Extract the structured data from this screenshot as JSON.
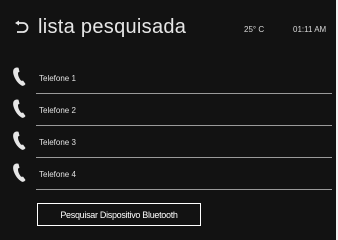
{
  "header": {
    "back_icon": "back-arrow-icon",
    "title": "lista pesquisada",
    "temperature": "25° C",
    "time": "01:11 AM"
  },
  "devices": [
    {
      "label": "Telefone 1",
      "icon": "phone-icon"
    },
    {
      "label": "Telefone 2",
      "icon": "phone-icon"
    },
    {
      "label": "Telefone 3",
      "icon": "phone-icon"
    },
    {
      "label": "Telefone 4",
      "icon": "phone-icon"
    }
  ],
  "search_button": {
    "label": "Pesquisar Dispositivo Bluetooth"
  },
  "colors": {
    "background": "#121212",
    "text": "#ffffff",
    "divider": "#9a9a9a"
  }
}
